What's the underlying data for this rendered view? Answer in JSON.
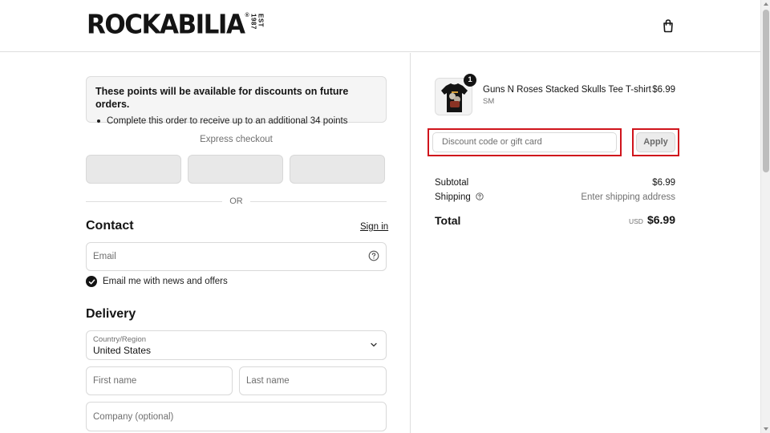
{
  "header": {
    "logo_text": "ROCKABILIA",
    "logo_reg": "®",
    "logo_est": "EST 1987",
    "cart_icon": "shopping-bag-icon"
  },
  "points": {
    "title": "These points will be available for discounts on future orders.",
    "bullet": "Complete this order to receive up to an additional 34 points"
  },
  "express": {
    "label": "Express checkout",
    "buttons": [
      "",
      "",
      ""
    ]
  },
  "divider": {
    "or_text": "OR"
  },
  "contact": {
    "title": "Contact",
    "sign_in": "Sign in",
    "email_placeholder": "Email",
    "newsletter_label": "Email me with news and offers",
    "newsletter_checked": true
  },
  "delivery": {
    "title": "Delivery",
    "country_label": "Country/Region",
    "country_value": "United States",
    "first_name_placeholder": "First name",
    "last_name_placeholder": "Last name",
    "company_placeholder": "Company (optional)"
  },
  "order": {
    "item": {
      "name": "Guns N Roses Stacked Skulls Tee T-shirt",
      "variant": "SM",
      "price": "$6.99",
      "quantity": "1"
    },
    "discount_placeholder": "Discount code or gift card",
    "apply_label": "Apply",
    "subtotal_label": "Subtotal",
    "subtotal_value": "$6.99",
    "shipping_label": "Shipping",
    "shipping_value": "Enter shipping address",
    "total_label": "Total",
    "currency": "USD",
    "total_value": "$6.99"
  },
  "colors": {
    "highlight_border": "#d0141c",
    "text_primary": "#141414",
    "muted": "#707070"
  }
}
